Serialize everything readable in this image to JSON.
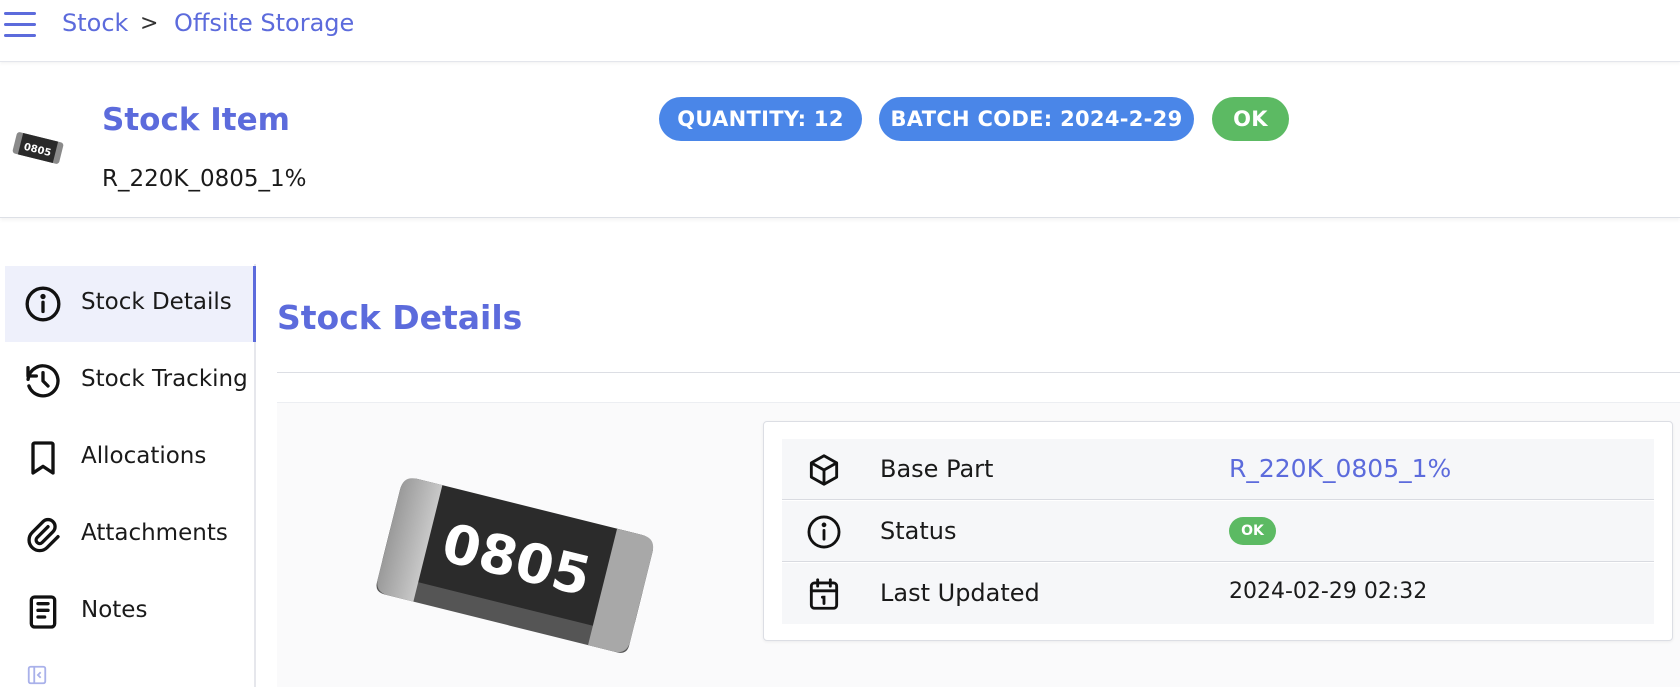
{
  "breadcrumb": {
    "items": [
      "Stock",
      "Offsite Storage"
    ],
    "separator": ">"
  },
  "header": {
    "title": "Stock Item",
    "subtitle": "R_220K_0805_1%",
    "thumbnail_label": "0805",
    "badges": [
      {
        "text": "QUANTITY: 12",
        "color": "#4a86e8"
      },
      {
        "text": "BATCH CODE: 2024-2-29",
        "color": "#4a86e8"
      },
      {
        "text": "OK",
        "color": "#5cba63"
      }
    ]
  },
  "sidebar": {
    "items": [
      {
        "label": "Stock Details",
        "icon": "info-circle-icon",
        "active": true
      },
      {
        "label": "Stock Tracking",
        "icon": "history-icon",
        "active": false
      },
      {
        "label": "Allocations",
        "icon": "bookmark-icon",
        "active": false
      },
      {
        "label": "Attachments",
        "icon": "paperclip-icon",
        "active": false
      },
      {
        "label": "Notes",
        "icon": "notes-icon",
        "active": false
      }
    ]
  },
  "main": {
    "section_title": "Stock Details",
    "image_label": "0805",
    "details": [
      {
        "label": "Base Part",
        "value": "R_220K_0805_1%",
        "icon": "package-icon",
        "kind": "link"
      },
      {
        "label": "Status",
        "value": "OK",
        "icon": "info-circle-icon",
        "kind": "badge"
      },
      {
        "label": "Last Updated",
        "value": "2024-02-29 02:32",
        "icon": "calendar-icon",
        "kind": "text"
      }
    ]
  },
  "colors": {
    "accent": "#5c6bdc",
    "badge_blue": "#4a86e8",
    "badge_green": "#5cba63"
  }
}
